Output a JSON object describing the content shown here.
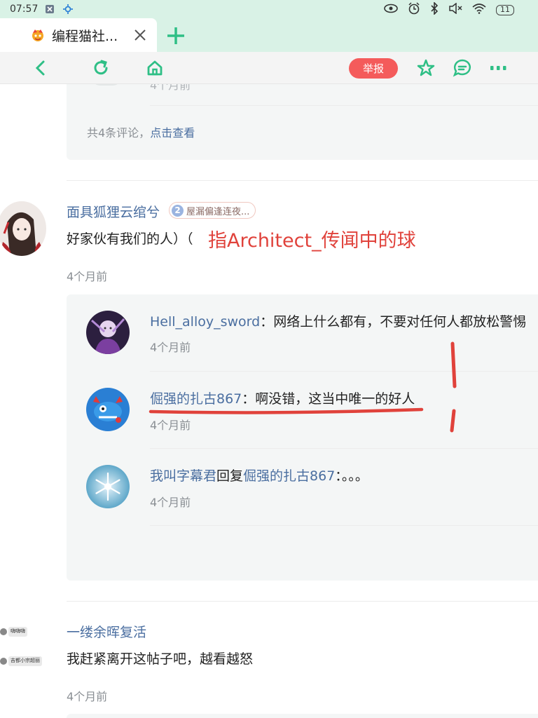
{
  "status_bar": {
    "time": "07:57",
    "battery": "11",
    "icons": [
      "sim-icon",
      "settings-icon",
      "eye-icon",
      "alarm-icon",
      "bluetooth-icon",
      "mute-icon",
      "wifi-icon"
    ]
  },
  "tab": {
    "title": "编程猫社...",
    "favicon": "codemao-logo-icon"
  },
  "toolbar": {
    "report_label": "举报",
    "icons": [
      "back-icon",
      "refresh-icon",
      "home-icon",
      "star-icon",
      "comment-icon",
      "more-icon"
    ]
  },
  "colors": {
    "accent": "#2fbf86",
    "report": "#f45b5b",
    "link": "#4a6ea0",
    "annotation": "#e0423b"
  },
  "prev_comment": {
    "partial_time": "4个月前",
    "summary_prefix": "共4条评论，",
    "summary_link": "点击查看"
  },
  "comment1": {
    "username": "面具狐狸云绾兮",
    "badge_level": "2",
    "badge_text": "屋漏偏逢连夜...",
    "text": "好家伙有我们的人）（",
    "annotation": "指Architect_传闻中的球",
    "time": "4个月前",
    "replies": [
      {
        "user": "Hell_alloy_sword",
        "sep": "：",
        "text": "网络上什么都有，不要对任何人都放松警惕",
        "time": "4个月前"
      },
      {
        "user": "倔强的扎古867",
        "sep": "：",
        "text": "啊没错，这当中唯一的好人",
        "time": "4个月前"
      },
      {
        "user": "我叫字幕君",
        "mid": "回复",
        "target": "倔强的扎古867",
        "sep": "：",
        "text": "。。。",
        "time": "4个月前"
      }
    ]
  },
  "comment2": {
    "username": "一缕余晖复活",
    "text": "我赶紧离开这帖子吧，越看越怒",
    "time": "4个月前",
    "side_labels": [
      "嗨嗨嗨",
      "吉都小宗超丽"
    ]
  }
}
